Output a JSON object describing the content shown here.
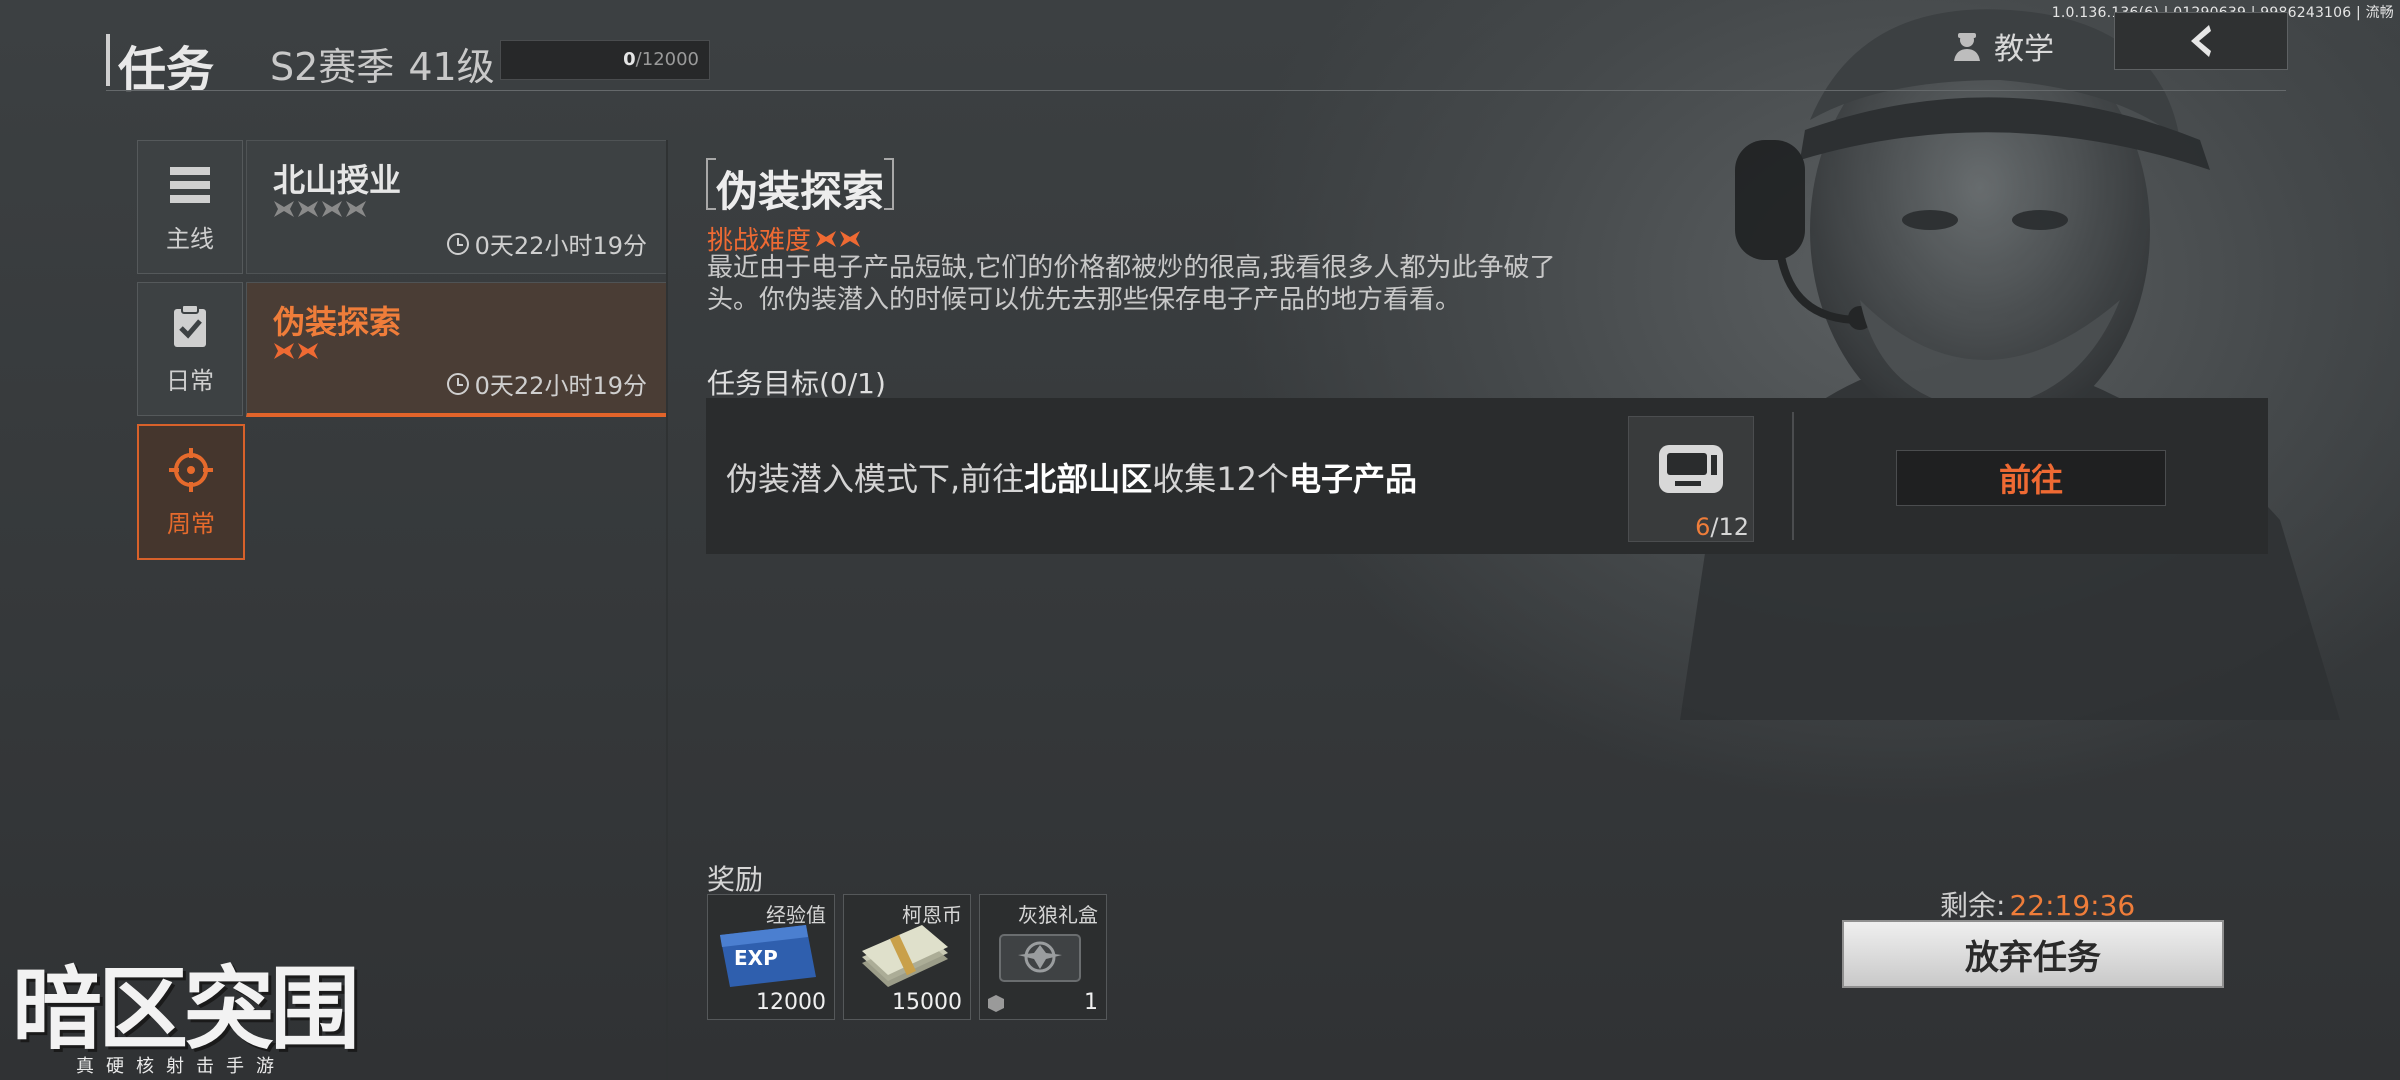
{
  "version": "1.0.136.136(6) | 01290639 | 9986243106 | 流畅",
  "header": {
    "title": "任务",
    "season": "S2赛季",
    "level": "41级",
    "xp_current": "0",
    "xp_max": "/12000",
    "xp_fraction": 0,
    "teach_label": "教学"
  },
  "categories": [
    {
      "label": "主线",
      "icon": "list-icon"
    },
    {
      "label": "日常",
      "icon": "clipboard-check-icon"
    },
    {
      "label": "周常",
      "icon": "crosshair-icon"
    }
  ],
  "tasks": [
    {
      "name": "北山授业",
      "time": "0天22小时19分",
      "stars": 4,
      "star_color": "#8a8a8a"
    },
    {
      "name": "伪装探索",
      "time": "0天22小时19分",
      "stars": 2,
      "star_color": "#ef6a33"
    }
  ],
  "detail": {
    "title": "伪装探索",
    "difficulty_label": "挑战难度",
    "difficulty_stars": 2,
    "description": "最近由于电子产品短缺,它们的价格都被炒的很高,我看很多人都为此争破了头。你伪装潜入的时候可以优先去那些保存电子产品的地方看看。",
    "objective_title": "任务目标(0/1)",
    "objective": {
      "prefix": "伪装潜入模式下,前往",
      "location": "北部山区",
      "middle": "收集12个",
      "target": "电子产品",
      "item_icon": "pager-icon",
      "count_current": "6",
      "count_total": "/12"
    },
    "go_label": "前往"
  },
  "rewards": {
    "title": "奖励",
    "items": [
      {
        "name": "经验值",
        "qty": "12000",
        "icon": "exp-card-icon"
      },
      {
        "name": "柯恩币",
        "qty": "15000",
        "icon": "money-stack-icon"
      },
      {
        "name": "灰狼礼盒",
        "qty": "1",
        "icon": "gift-box-icon"
      }
    ]
  },
  "remaining": {
    "label": "剩余:",
    "time": "22:19:36"
  },
  "abandon_label": "放弃任务",
  "logo": {
    "title": "暗区突围",
    "subtitle": "真硬核射击手游"
  },
  "colors": {
    "accent": "#ef6a33",
    "panel": "#2a2c2d",
    "background": "#3a3d3f"
  }
}
